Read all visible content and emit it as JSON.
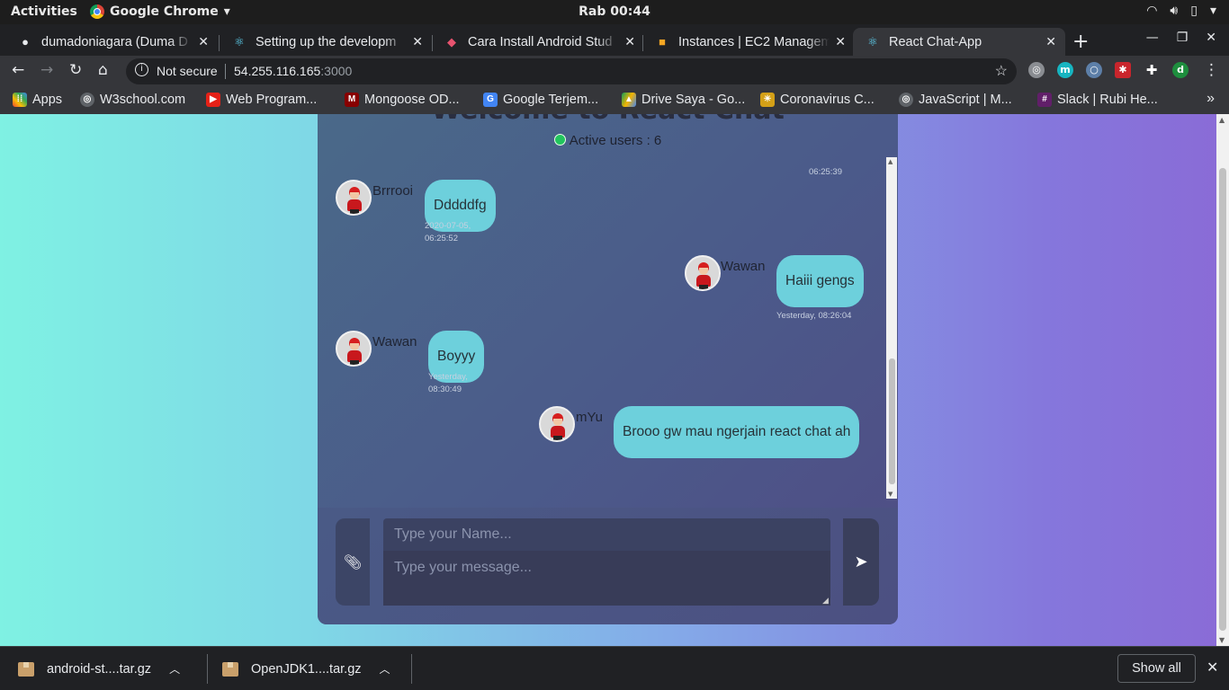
{
  "topbar": {
    "activities": "Activities",
    "app_name": "Google Chrome",
    "clock": "Rab 00:44"
  },
  "tabs": [
    {
      "title": "dumadoniagara (Duma D",
      "icon": "github-icon"
    },
    {
      "title": "Setting up the developm",
      "icon": "react-icon"
    },
    {
      "title": "Cara Install Android Stud",
      "icon": "site-icon"
    },
    {
      "title": "Instances | EC2 Managem",
      "icon": "aws-icon"
    },
    {
      "title": "React Chat-App",
      "icon": "react-icon",
      "active": true
    }
  ],
  "omnibox": {
    "security": "Not secure",
    "host": "54.255.116.165",
    "port": ":3000"
  },
  "extensions": [
    "globe-icon",
    "m-extension-icon",
    "circle-extension-icon",
    "red-extension-icon",
    "puzzle-icon"
  ],
  "profile_initial": "d",
  "bookmarks": [
    {
      "label": "Apps",
      "icon": "apps-grid-icon"
    },
    {
      "label": "W3school.com",
      "icon": "globe-icon"
    },
    {
      "label": "Web Program...",
      "icon": "youtube-icon"
    },
    {
      "label": "Mongoose OD...",
      "icon": "mongoose-icon"
    },
    {
      "label": "Google Terjem...",
      "icon": "google-translate-icon"
    },
    {
      "label": "Drive Saya - Go...",
      "icon": "google-drive-icon"
    },
    {
      "label": "Coronavirus C...",
      "icon": "covid-icon"
    },
    {
      "label": "JavaScript | M...",
      "icon": "globe-icon"
    },
    {
      "label": "Slack | Rubi He...",
      "icon": "slack-icon"
    }
  ],
  "chat": {
    "title": "Welcome to React Chat",
    "active_users": "Active users : 6",
    "top_timestamp": "06:25:39",
    "messages": [
      {
        "sender": "Brrrooi",
        "text": "Dddddfg",
        "time": "2020-07-05, 06:25:52",
        "time_line1": "2020-07-05,",
        "time_line2": "06:25:52",
        "side": "left"
      },
      {
        "sender": "Wawan",
        "text": "Haiii gengs",
        "time": "Yesterday, 08:26:04",
        "side": "right"
      },
      {
        "sender": "Wawan",
        "text": "Boyyy",
        "time": "Yesterday, 08:30:49",
        "time_line1": "Yesterday,",
        "time_line2": "08:30:49",
        "side": "left"
      },
      {
        "sender": "mYu",
        "text": "Brooo gw mau ngerjain react chat ah",
        "time": "",
        "side": "right"
      }
    ],
    "name_placeholder": "Type your Name...",
    "message_placeholder": "Type your message..."
  },
  "downloads": [
    {
      "name": "android-st....tar.gz"
    },
    {
      "name": "OpenJDK1....tar.gz"
    }
  ],
  "show_all_label": "Show all"
}
